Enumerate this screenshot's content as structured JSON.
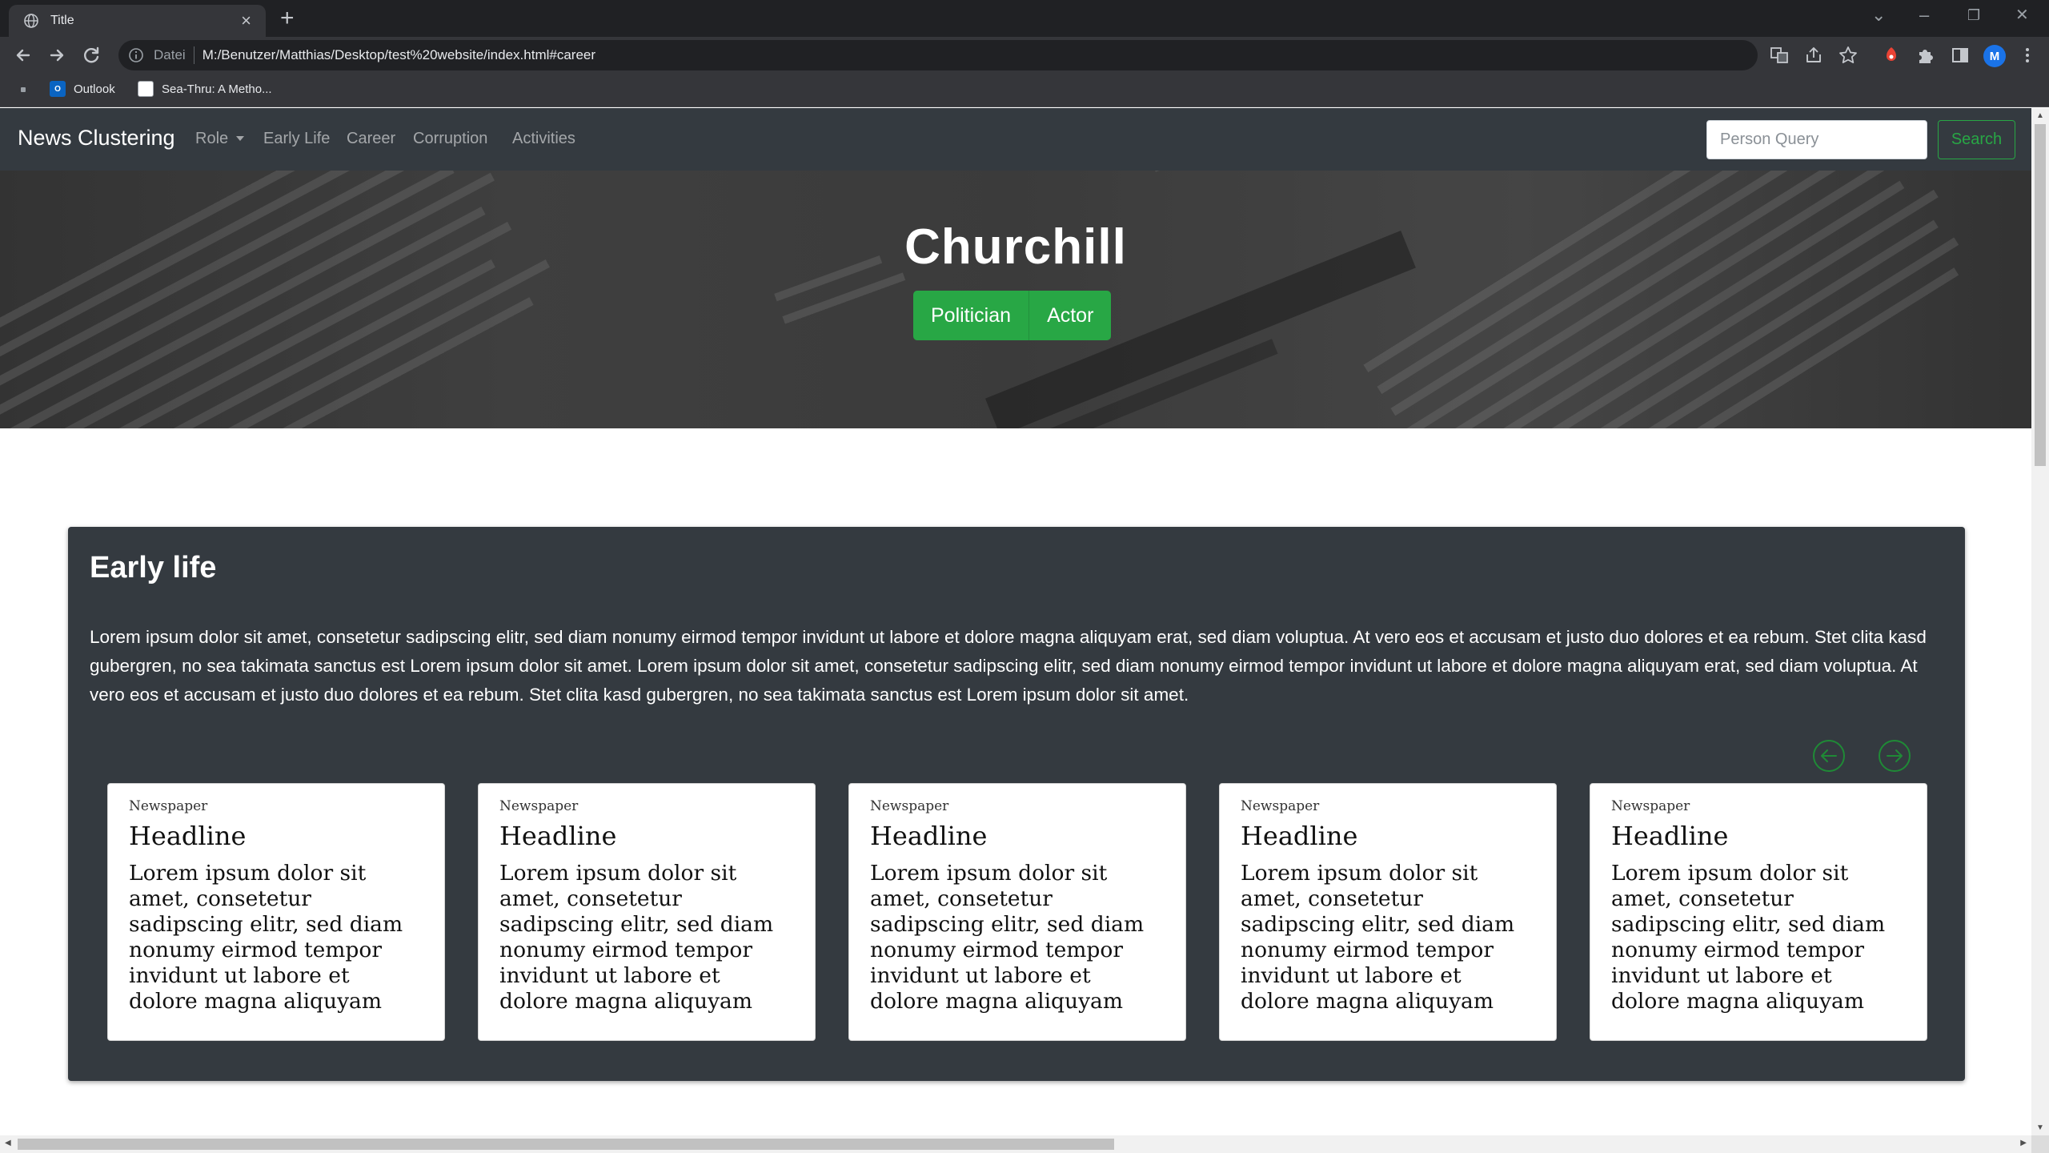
{
  "browser": {
    "tab_title": "Title",
    "tab_close": "×",
    "new_tab": "+",
    "url_scheme": "Datei",
    "url": "M:/Benutzer/Matthias/Desktop/test%20website/index.html#career",
    "bookmarks": [
      "Outlook",
      "Sea-Thru: A Metho..."
    ],
    "profile_initial": "M",
    "window_controls": [
      "⌄",
      "–",
      "❐",
      "✕"
    ]
  },
  "navbar": {
    "brand": "News Clustering",
    "links": [
      "Role",
      "Early Life",
      "Career",
      "Corruption",
      "Activities"
    ],
    "search_placeholder": "Person Query",
    "search_button": "Search"
  },
  "hero": {
    "title": "Churchill",
    "roles": [
      "Politician",
      "Actor"
    ]
  },
  "section": {
    "title": "Early life",
    "text": "Lorem ipsum dolor sit amet, consetetur sadipscing elitr, sed diam nonumy eirmod tempor invidunt ut labore et dolore magna aliquyam erat, sed diam voluptua. At vero eos et accusam et justo duo dolores et ea rebum. Stet clita kasd gubergren, no sea takimata sanctus est Lorem ipsum dolor sit amet. Lorem ipsum dolor sit amet, consetetur sadipscing elitr, sed diam nonumy eirmod tempor invidunt ut labore et dolore magna aliquyam erat, sed diam voluptua. At vero eos et accusam et justo duo dolores et ea rebum. Stet clita kasd gubergren, no sea takimata sanctus est Lorem ipsum dolor sit amet.",
    "cards": [
      {
        "source": "Newspaper",
        "headline": "Headline",
        "body": "Lorem ipsum dolor sit amet, consetetur sadipscing elitr, sed diam nonumy eirmod tempor invidunt ut labore et dolore magna aliquyam"
      },
      {
        "source": "Newspaper",
        "headline": "Headline",
        "body": "Lorem ipsum dolor sit amet, consetetur sadipscing elitr, sed diam nonumy eirmod tempor invidunt ut labore et dolore magna aliquyam"
      },
      {
        "source": "Newspaper",
        "headline": "Headline",
        "body": "Lorem ipsum dolor sit amet, consetetur sadipscing elitr, sed diam nonumy eirmod tempor invidunt ut labore et dolore magna aliquyam"
      },
      {
        "source": "Newspaper",
        "headline": "Headline",
        "body": "Lorem ipsum dolor sit amet, consetetur sadipscing elitr, sed diam nonumy eirmod tempor invidunt ut labore et dolore magna aliquyam"
      },
      {
        "source": "Newspaper",
        "headline": "Headline",
        "body": "Lorem ipsum dolor sit amet, consetetur sadipscing elitr, sed diam nonumy eirmod tempor invidunt ut labore et dolore magna aliquyam"
      }
    ]
  },
  "colors": {
    "accent_green": "#28a745",
    "navbar_bg": "#343a40",
    "chrome_dark": "#202124",
    "chrome_toolbar": "#35363a"
  },
  "icons": {
    "tab": "globe-icon",
    "back": "arrow-left-icon",
    "forward": "arrow-right-icon",
    "reload": "reload-icon",
    "info": "info-icon",
    "translate": "translate-icon",
    "share": "share-icon",
    "bookmark": "star-icon",
    "extension_red": "extension-icon",
    "extensions": "puzzle-icon",
    "side_panel": "side-panel-icon",
    "menu": "kebab-menu-icon",
    "carousel_prev": "chevron-left-circle-icon",
    "carousel_next": "chevron-right-circle-icon"
  }
}
